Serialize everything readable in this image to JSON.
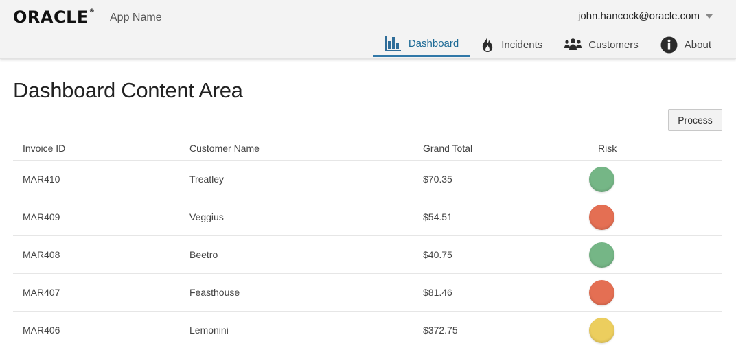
{
  "header": {
    "logo_text": "ORACLE",
    "logo_mark": "®",
    "app_name": "App Name",
    "user_email": "john.hancock@oracle.com"
  },
  "nav": {
    "items": [
      {
        "label": "Dashboard",
        "icon": "bar-chart-icon",
        "active": true
      },
      {
        "label": "Incidents",
        "icon": "fire-icon",
        "active": false
      },
      {
        "label": "Customers",
        "icon": "people-icon",
        "active": false
      },
      {
        "label": "About",
        "icon": "info-icon",
        "active": false
      }
    ]
  },
  "main": {
    "title": "Dashboard Content Area",
    "process_label": "Process"
  },
  "table": {
    "headers": [
      "Invoice ID",
      "Customer Name",
      "Grand Total",
      "Risk"
    ],
    "rows": [
      {
        "id": "MAR410",
        "name": "Treatley",
        "total": "$70.35",
        "risk": "low",
        "risk_color": "#75b686"
      },
      {
        "id": "MAR409",
        "name": "Veggius",
        "total": "$54.51",
        "risk": "high",
        "risk_color": "#e46f53"
      },
      {
        "id": "MAR408",
        "name": "Beetro",
        "total": "$40.75",
        "risk": "low",
        "risk_color": "#75b686"
      },
      {
        "id": "MAR407",
        "name": "Feasthouse",
        "total": "$81.46",
        "risk": "high",
        "risk_color": "#e46f53"
      },
      {
        "id": "MAR406",
        "name": "Lemonini",
        "total": "$372.75",
        "risk": "medium",
        "risk_color": "#ecce5e"
      }
    ]
  },
  "colors": {
    "accent": "#3178a8",
    "header_bg": "#f3f3f3"
  }
}
